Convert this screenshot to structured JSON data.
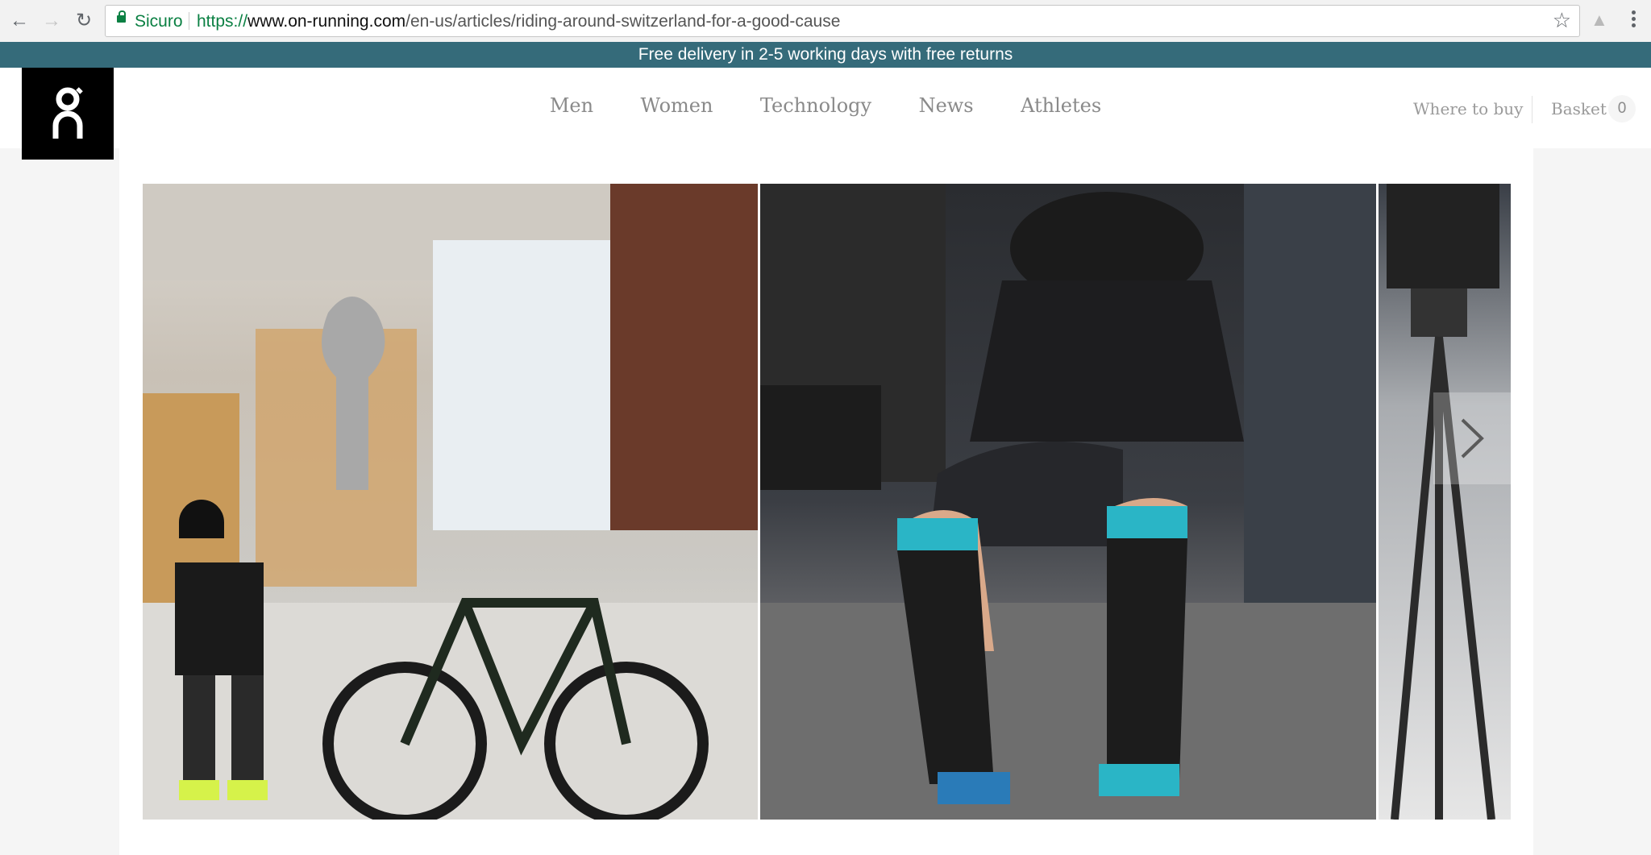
{
  "browser": {
    "secure_label": "Sicuro",
    "url_protocol": "https://",
    "url_host": "www.on-running.com",
    "url_path": "/en-us/articles/riding-around-switzerland-for-a-good-cause"
  },
  "promo": {
    "text": "Free delivery in 2-5 working days with free returns"
  },
  "nav": {
    "items": [
      {
        "label": "Men"
      },
      {
        "label": "Women"
      },
      {
        "label": "Technology"
      },
      {
        "label": "News"
      },
      {
        "label": "Athletes"
      }
    ]
  },
  "header": {
    "where_to_buy": "Where to buy",
    "basket_label": "Basket",
    "basket_count": "0"
  },
  "icons": {
    "back": "arrow-left-icon",
    "forward": "arrow-right-icon",
    "reload": "reload-icon",
    "lock": "lock-icon",
    "bookmark": "star-icon",
    "extension": "drive-icon",
    "menu": "kebab-menu-icon",
    "next": "chevron-right-icon"
  },
  "colors": {
    "promo_bg": "#356b7a",
    "secure_green": "#0b8043",
    "logo_bg": "#000000"
  }
}
